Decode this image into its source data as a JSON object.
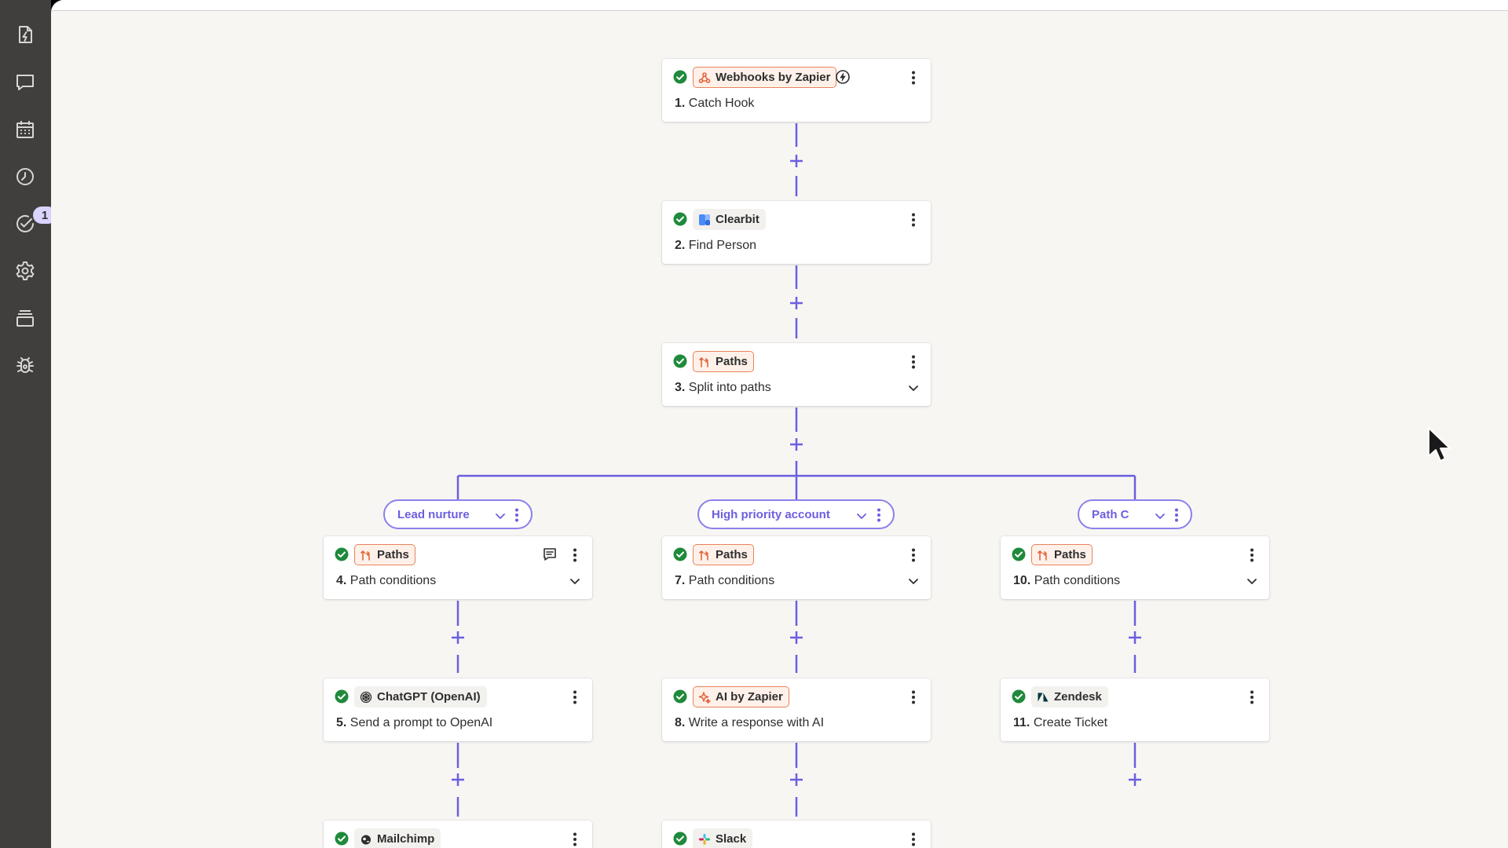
{
  "sidebar": {
    "items": [
      {
        "icon": "zap-file-icon",
        "name": "sidebar-item-zaps"
      },
      {
        "icon": "chat-icon",
        "name": "sidebar-item-comments"
      },
      {
        "icon": "calendar-icon",
        "name": "sidebar-item-calendar"
      },
      {
        "icon": "clock-icon",
        "name": "sidebar-item-history"
      },
      {
        "icon": "status-icon",
        "name": "sidebar-item-status",
        "badge": "1"
      },
      {
        "icon": "gear-icon",
        "name": "sidebar-item-settings"
      },
      {
        "icon": "layers-icon",
        "name": "sidebar-item-versions"
      },
      {
        "icon": "bug-icon",
        "name": "sidebar-item-debug"
      }
    ]
  },
  "colors": {
    "connector": "#6b5fe0",
    "check": "#1f8a3b",
    "chip_border": "#e7835b",
    "sidebar": "#403f3e",
    "canvas": "#f7f6f3"
  },
  "steps": {
    "s1": {
      "app": "Webhooks by Zapier",
      "icon": "webhook-icon",
      "number": "1.",
      "title": "Catch Hook"
    },
    "s2": {
      "app": "Clearbit",
      "icon": "clearbit-icon",
      "number": "2.",
      "title": "Find Person"
    },
    "s3": {
      "app": "Paths",
      "icon": "paths-icon",
      "number": "3.",
      "title": "Split into paths"
    },
    "s4": {
      "app": "Paths",
      "icon": "paths-icon",
      "number": "4.",
      "title": "Path conditions"
    },
    "s5": {
      "app": "ChatGPT (OpenAI)",
      "icon": "openai-icon",
      "number": "5.",
      "title": "Send a prompt to OpenAI"
    },
    "s6": {
      "app": "Mailchimp",
      "icon": "mailchimp-icon"
    },
    "s7": {
      "app": "Paths",
      "icon": "paths-icon",
      "number": "7.",
      "title": "Path conditions"
    },
    "s8": {
      "app": "AI by Zapier",
      "icon": "ai-sparkle-icon",
      "number": "8.",
      "title": "Write a response with AI"
    },
    "s9": {
      "app": "Slack",
      "icon": "slack-icon"
    },
    "s10": {
      "app": "Paths",
      "icon": "paths-icon",
      "number": "10.",
      "title": "Path conditions"
    },
    "s11": {
      "app": "Zendesk",
      "icon": "zendesk-icon",
      "number": "11.",
      "title": "Create Ticket"
    }
  },
  "paths": {
    "a": {
      "label": "Lead nurture"
    },
    "b": {
      "label": "High priority account"
    },
    "c": {
      "label": "Path C"
    }
  }
}
